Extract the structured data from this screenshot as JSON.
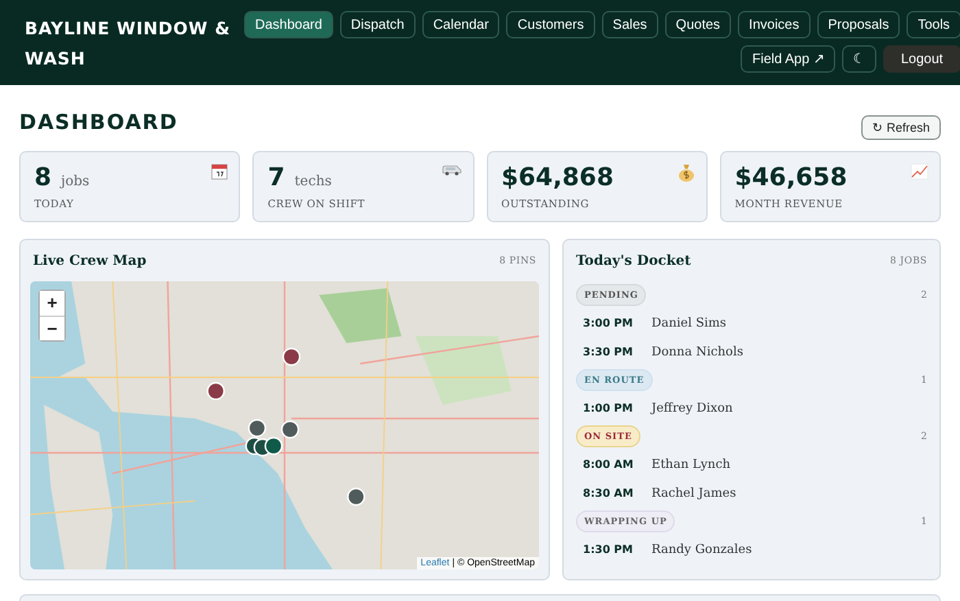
{
  "brand": "BAYLINE WINDOW & WASH",
  "nav": [
    {
      "label": "Dashboard",
      "selected": true
    },
    {
      "label": "Dispatch",
      "selected": false
    },
    {
      "label": "Calendar",
      "selected": false
    },
    {
      "label": "Customers",
      "selected": false
    },
    {
      "label": "Sales",
      "selected": false
    },
    {
      "label": "Quotes",
      "selected": false
    },
    {
      "label": "Invoices",
      "selected": false
    },
    {
      "label": "Proposals",
      "selected": false
    },
    {
      "label": "Tools",
      "selected": false
    }
  ],
  "actions": {
    "field_app": "Field App ↗",
    "theme": "☾",
    "logout": "Logout"
  },
  "page_title": "DASHBOARD",
  "refresh": "↻ Refresh",
  "stats": [
    {
      "kind": "calendar",
      "value": "8",
      "unit": "jobs",
      "label": "TODAY"
    },
    {
      "kind": "van",
      "value": "7",
      "unit": "techs",
      "label": "CREW ON SHIFT"
    },
    {
      "kind": "money",
      "value": "$64,868",
      "label": "OUTSTANDING"
    },
    {
      "kind": "chart",
      "value": "$46,658",
      "label": "MONTH REVENUE"
    }
  ],
  "map_panel": {
    "title": "Live Crew Map",
    "count": "8 PINS",
    "zoom_in": "+",
    "zoom_out": "−",
    "attribution_link": "Leaflet",
    "attribution_text": "| © OpenStreetMap"
  },
  "docket": {
    "title": "Today's Docket",
    "count": "8 JOBS",
    "groups": [
      {
        "kind": "pending",
        "status": "PENDING",
        "count": "2",
        "jobs": [
          {
            "time": "3:00 PM",
            "name": "Daniel Sims"
          },
          {
            "time": "3:30 PM",
            "name": "Donna Nichols"
          }
        ]
      },
      {
        "kind": "en_route",
        "status": "EN ROUTE",
        "count": "1",
        "jobs": [
          {
            "time": "1:00 PM",
            "name": "Jeffrey Dixon"
          }
        ]
      },
      {
        "kind": "on_site",
        "status": "ON SITE",
        "count": "2",
        "jobs": [
          {
            "time": "8:00 AM",
            "name": "Ethan Lynch"
          },
          {
            "time": "8:30 AM",
            "name": "Rachel James"
          }
        ]
      },
      {
        "kind": "wrapping_up",
        "status": "WRAPPING UP",
        "count": "1",
        "jobs": [
          {
            "time": "1:30 PM",
            "name": "Randy Gonzales"
          }
        ]
      }
    ]
  }
}
